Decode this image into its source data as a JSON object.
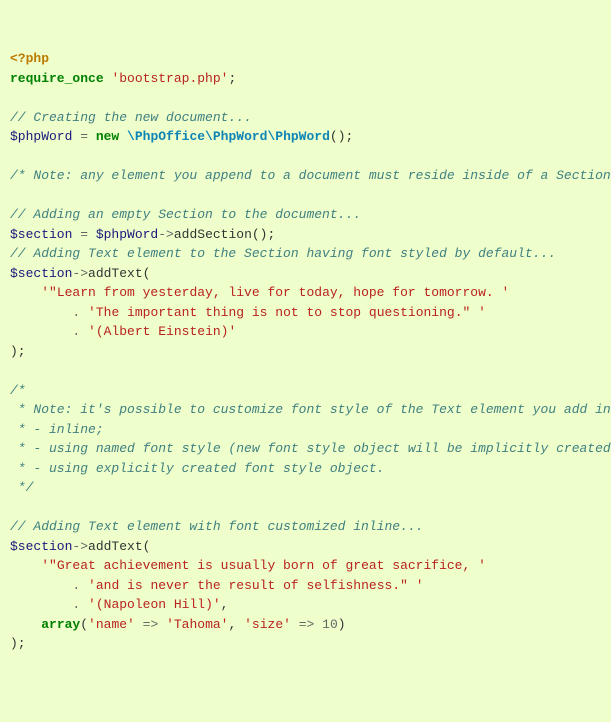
{
  "code": {
    "open": "<?php",
    "require": "require_once",
    "bootstrap": "'bootstrap.php'",
    "semi": ";",
    "c1": "// Creating the new document...",
    "phpWord": "$phpWord",
    "eq": " = ",
    "new": "new",
    "cls": "\\PhpOffice\\PhpWord\\PhpWord",
    "paren": "();",
    "c2": "/* Note: any element you append to a document must reside inside of a Section. */",
    "c3": "// Adding an empty Section to the document...",
    "section": "$section",
    "arrow": "->",
    "addSection": "addSection",
    "c4": "// Adding Text element to the Section having font styled by default...",
    "addText": "addText",
    "open_p": "(",
    "s1a": "'\"Learn from yesterday, live for today, hope for tomorrow. '",
    "dot": ".",
    "sp": " ",
    "s1b": "'The important thing is not to stop questioning.\" '",
    "s1c": "'(Albert Einstein)'",
    "close_p": ");",
    "c5a": "/*",
    "c5b": " * Note: it's possible to customize font style of the Text element you add in three ways:",
    "c5c": " * - inline;",
    "c5d": " * - using named font style (new font style object will be implicitly created);",
    "c5e": " * - using explicitly created font style object.",
    "c5f": " */",
    "c6": "// Adding Text element with font customized inline...",
    "s2a": "'\"Great achievement is usually born of great sacrifice, '",
    "s2b": "'and is never the result of selfishness.\" '",
    "s2c": "'(Napoleon Hill)'",
    "comma": ",",
    "array": "array",
    "name_k": "'name'",
    "fat": " => ",
    "tahoma": "'Tahoma'",
    "size_k": "'size'",
    "ten": "10",
    "close_arr": ")"
  }
}
